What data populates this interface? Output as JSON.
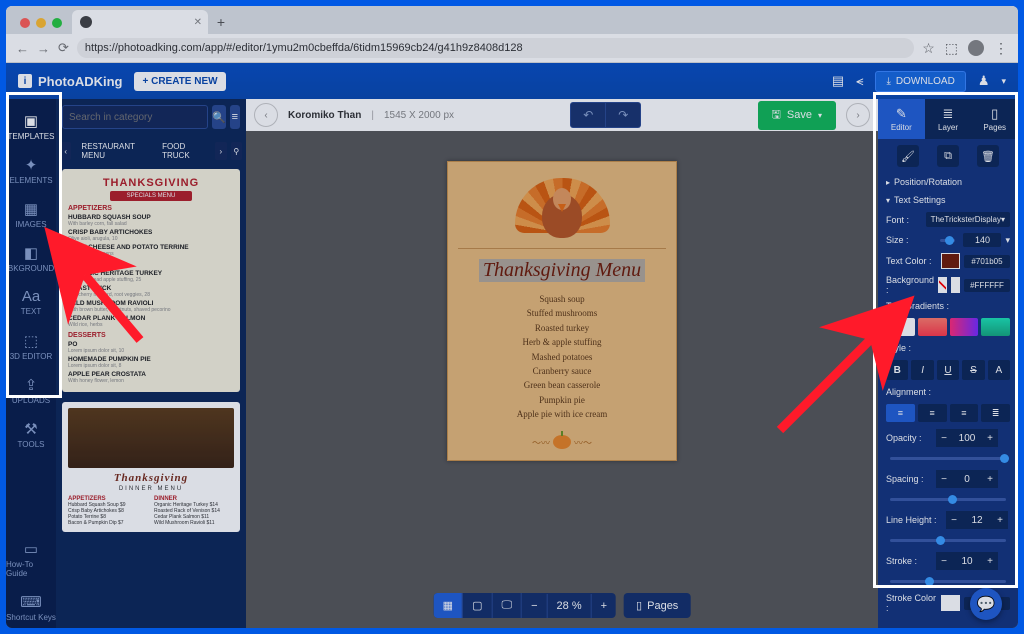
{
  "browser": {
    "url": "https://photoadking.com/app/#/editor/1ymu2m0cbeffda/6tidm15969cb24/g41h9z8408d128",
    "tab_title": ""
  },
  "app": {
    "logo_text": "PhotoADKing",
    "create_new": "+ CREATE NEW",
    "download": "DOWNLOAD"
  },
  "rail": {
    "items": [
      {
        "label": "TEMPLATES",
        "icon": "▣"
      },
      {
        "label": "ELEMENTS",
        "icon": "✦"
      },
      {
        "label": "IMAGES",
        "icon": "▦"
      },
      {
        "label": "BKGROUND",
        "icon": "◧"
      },
      {
        "label": "TEXT",
        "icon": "Aa"
      },
      {
        "label": "3D EDITOR",
        "icon": "⬚"
      },
      {
        "label": "UPLOADS",
        "icon": "⇪"
      },
      {
        "label": "TOOLS",
        "icon": "⚒"
      }
    ],
    "bottom": [
      {
        "label": "How-To Guide",
        "icon": "▭"
      },
      {
        "label": "Shortcut Keys",
        "icon": "⌨"
      }
    ]
  },
  "leftpanel": {
    "search_placeholder": "Search in category",
    "categories": [
      "RESTAURANT MENU",
      "FOOD TRUCK"
    ],
    "tpl1": {
      "title": "THANKSGIVING",
      "subtitle": "SPECIALS MENU",
      "sections": [
        {
          "name": "APPETIZERS",
          "dishes": [
            {
              "name": "HUBBARD SQUASH SOUP",
              "desc": "With barley corn, fall salad"
            },
            {
              "name": "CRISP BABY ARTICHOKES",
              "desc": "Olive aioli, arugula, 10"
            },
            {
              "name": "GOAT CHEESE AND POTATO TERRINE",
              "desc": "Fennel, microgreens"
            }
          ]
        },
        {
          "name": "ENTREES",
          "dishes": [
            {
              "name": "ORGANIC HERITAGE TURKEY",
              "desc": "With cornbread apple stuffing, 25"
            },
            {
              "name": "ROAST DUCK",
              "desc": "with cherry mustard, root veggies, 28"
            },
            {
              "name": "WILD MUSHROOM RAVIOLI",
              "desc": "With brown butter, chestnuts, shaved pecorino"
            },
            {
              "name": "CEDAR PLANK SALMON",
              "desc": "Wild rice, herbs"
            }
          ]
        },
        {
          "name": "DESSERTS",
          "dishes": [
            {
              "name": "PO",
              "desc": "Lorem ipsum dolor sit, 10"
            },
            {
              "name": "HOMEMADE PUMPKIN PIE",
              "desc": "Lorem ipsum dolor sit, 8"
            },
            {
              "name": "APPLE PEAR CROSTATA",
              "desc": "With honey flower, lemon"
            }
          ]
        }
      ]
    },
    "tpl2": {
      "title": "Thanksgiving",
      "subtitle": "DINNER MENU",
      "cols": [
        {
          "heading": "APPETIZERS",
          "rows": [
            "Hubbard Squash Soup          $9",
            "Crisp Baby Artichokes         $8",
            "Potato Terrine                 $8",
            "Bacon & Pumpkin Dip           $7"
          ]
        },
        {
          "heading": "DINNER",
          "rows": [
            "Organic Heritage Turkey       $14",
            "Roasted Rack of Venison       $14",
            "Cedar Plank Salmon            $11",
            "Wild Mushroom Ravioli         $11"
          ]
        }
      ]
    }
  },
  "canvas": {
    "title": "Koromiko Than",
    "dims": "1545 X 2000 px",
    "save": "Save",
    "menu_title": "Thanksgiving Menu",
    "menu_items": [
      "Squash soup",
      "Stuffed mushrooms",
      "Roasted turkey",
      "Herb & apple stuffing",
      "Mashed potatoes",
      "Cranberry sauce",
      "Green bean casserole",
      "Pumpkin pie",
      "Apple pie with ice cream"
    ],
    "zoom": "28 %",
    "pages_btn": "Pages"
  },
  "right": {
    "tabs": [
      "Editor",
      "Layer",
      "Pages"
    ],
    "pos_rot": "Position/Rotation",
    "text_settings": "Text Settings",
    "font_label": "Font :",
    "font_value": "TheTricksterDisplay",
    "size_label": "Size :",
    "size_value": "140",
    "text_color_label": "Text Color :",
    "text_color_value": "#701b05",
    "bg_label": "Background :",
    "bg_value": "#FFFFFF",
    "gradients_label": "Text Gradients :",
    "style_label": "Style :",
    "styles": [
      "B",
      "I",
      "U",
      "S",
      "A"
    ],
    "align_label": "Alignment :",
    "opacity_label": "Opacity :",
    "opacity_value": "100",
    "spacing_label": "Spacing :",
    "spacing_value": "0",
    "lineheight_label": "Line Height :",
    "lineheight_value": "12",
    "stroke_label": "Stroke :",
    "stroke_value": "10",
    "stroke_color_label": "Stroke Color :",
    "stroke_color_value": "#ffffff"
  }
}
